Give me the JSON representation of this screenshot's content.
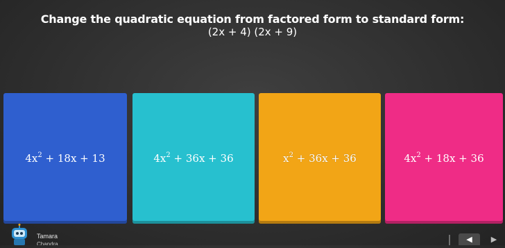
{
  "question": {
    "prompt": "Change the quadratic equation from factored form to standard form:",
    "equation": "(2x + 4) (2x + 9)"
  },
  "answers": [
    {
      "coef": "4x",
      "exp": "2",
      "rest": " + 18x + 13",
      "color": "#2f5fcf"
    },
    {
      "coef": "4x",
      "exp": "2",
      "rest": " + 36x + 36",
      "color": "#27c0cf"
    },
    {
      "coef": "x",
      "exp": "2",
      "rest": " + 36x + 36",
      "color": "#f2a516"
    },
    {
      "coef": "4x",
      "exp": "2",
      "rest": " + 18x + 36",
      "color": "#ef2c86"
    }
  ],
  "footer": {
    "student_name": "Tamara",
    "student_sub": "Chandra",
    "avatar_icon": "robot-avatar-icon",
    "prev_icon": "chevron-left-icon",
    "next_icon": "chevron-right-icon"
  }
}
